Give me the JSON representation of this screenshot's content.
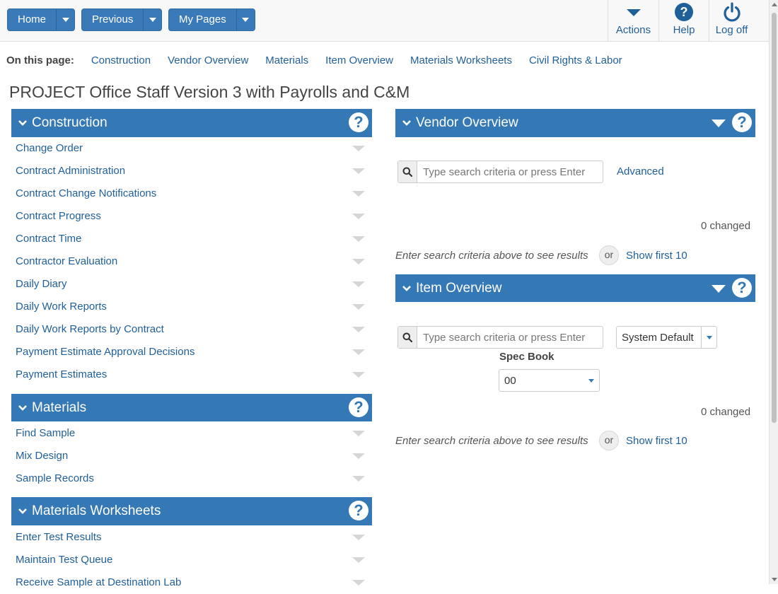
{
  "toolbar": {
    "home_label": "Home",
    "previous_label": "Previous",
    "mypages_label": "My Pages",
    "actions_label": "Actions",
    "help_label": "Help",
    "logoff_label": "Log off"
  },
  "on_this_page": {
    "label": "On this page:",
    "links": [
      "Construction",
      "Vendor Overview",
      "Materials",
      "Item Overview",
      "Materials Worksheets",
      "Civil Rights & Labor"
    ]
  },
  "page_title": "PROJECT Office Staff Version 3 with Payrolls and C&M",
  "construction": {
    "title": "Construction",
    "help": "?",
    "items": [
      "Change Order",
      "Contract Administration",
      "Contract Change Notifications",
      "Contract Progress",
      "Contract Time",
      "Contractor Evaluation",
      "Daily Diary",
      "Daily Work Reports",
      "Daily Work Reports by Contract",
      "Payment Estimate Approval Decisions",
      "Payment Estimates"
    ]
  },
  "materials": {
    "title": "Materials",
    "help": "?",
    "items": [
      "Find Sample",
      "Mix Design",
      "Sample Records"
    ]
  },
  "materials_worksheets": {
    "title": "Materials Worksheets",
    "help": "?",
    "items": [
      "Enter Test Results",
      "Maintain Test Queue",
      "Receive Sample at Destination Lab"
    ]
  },
  "vendor_overview": {
    "title": "Vendor Overview",
    "help": "?",
    "search_placeholder": "Type search criteria or press Enter",
    "advanced_label": "Advanced",
    "changed_text": "0 changed",
    "hint_text": "Enter search criteria above to see results",
    "or_text": "or",
    "show_first_label": "Show first 10"
  },
  "item_overview": {
    "title": "Item Overview",
    "help": "?",
    "search_placeholder": "Type search criteria or press Enter",
    "view_select_value": "System Default",
    "spec_book_label": "Spec Book",
    "spec_book_value": "00",
    "changed_text": "0 changed",
    "hint_text": "Enter search criteria above to see results",
    "or_text": "or",
    "show_first_label": "Show first 10"
  },
  "colors": {
    "accent": "#3478b5",
    "link": "#1f5f9a"
  }
}
